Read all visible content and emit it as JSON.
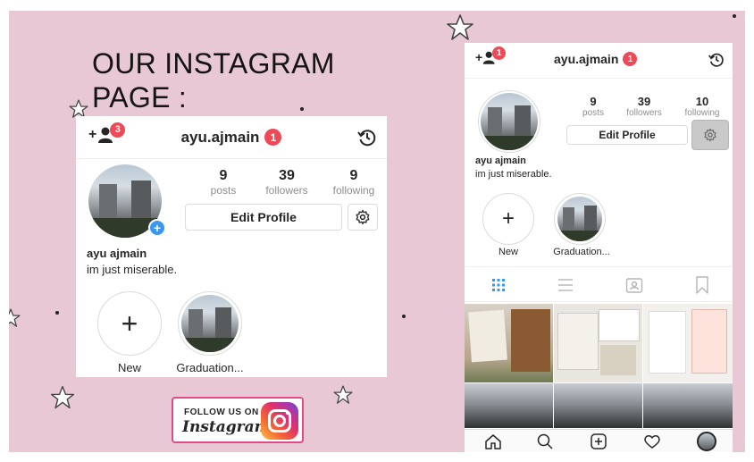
{
  "heading": {
    "line1": "OUR INSTAGRAM",
    "line2": "PAGE :"
  },
  "left_profile": {
    "username": "ayu.ajmain",
    "username_badge": "1",
    "add_user_badge": "3",
    "stats": [
      {
        "num": "9",
        "label": "posts"
      },
      {
        "num": "39",
        "label": "followers"
      },
      {
        "num": "9",
        "label": "following"
      }
    ],
    "edit_label": "Edit Profile",
    "bio_name": "ayu ajmain",
    "bio_text": "im just miserable.",
    "highlights": [
      {
        "label": "New"
      },
      {
        "label": "Graduation..."
      }
    ]
  },
  "follow_button": {
    "small": "FOLLOW US ON",
    "big": "Instagram"
  },
  "right_profile": {
    "username": "ayu.ajmain",
    "username_badge": "1",
    "add_user_badge": "1",
    "stats": [
      {
        "num": "9",
        "label": "posts"
      },
      {
        "num": "39",
        "label": "followers"
      },
      {
        "num": "10",
        "label": "following"
      }
    ],
    "edit_label": "Edit Profile",
    "bio_name": "ayu ajmain",
    "bio_text": "im just miserable.",
    "highlights": [
      {
        "label": "New"
      },
      {
        "label": "Graduation..."
      }
    ]
  },
  "colors": {
    "background": "#e8c8d4",
    "badge": "#ed4956",
    "accent_blue": "#3897f0"
  }
}
